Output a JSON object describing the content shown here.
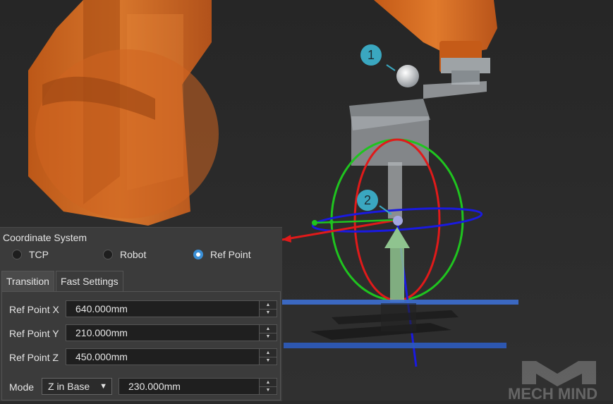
{
  "viewport": {
    "callouts": [
      {
        "label": "1"
      },
      {
        "label": "2"
      }
    ],
    "watermark": "MECH MIND"
  },
  "panel": {
    "title": "Coordinate System",
    "radios": [
      {
        "label": "TCP",
        "checked": false
      },
      {
        "label": "Robot",
        "checked": false
      },
      {
        "label": "Ref Point",
        "checked": true
      }
    ],
    "tabs": [
      {
        "label": "Transition",
        "active": true
      },
      {
        "label": "Fast Settings",
        "active": false
      }
    ],
    "fields": [
      {
        "label": "Ref Point X",
        "value": "640.000mm"
      },
      {
        "label": "Ref Point Y",
        "value": "210.000mm"
      },
      {
        "label": "Ref Point Z",
        "value": "450.000mm"
      }
    ],
    "mode": {
      "label": "Mode",
      "selected": "Z in Base",
      "value": "230.000mm"
    }
  },
  "colors": {
    "robot_orange": "#d86a1e",
    "accent_blue": "#3a8fd6",
    "callout_teal": "#3aa7c0",
    "axis_red": "#e01a1a",
    "axis_green": "#1fc41f",
    "axis_blue": "#1a1ae0"
  }
}
